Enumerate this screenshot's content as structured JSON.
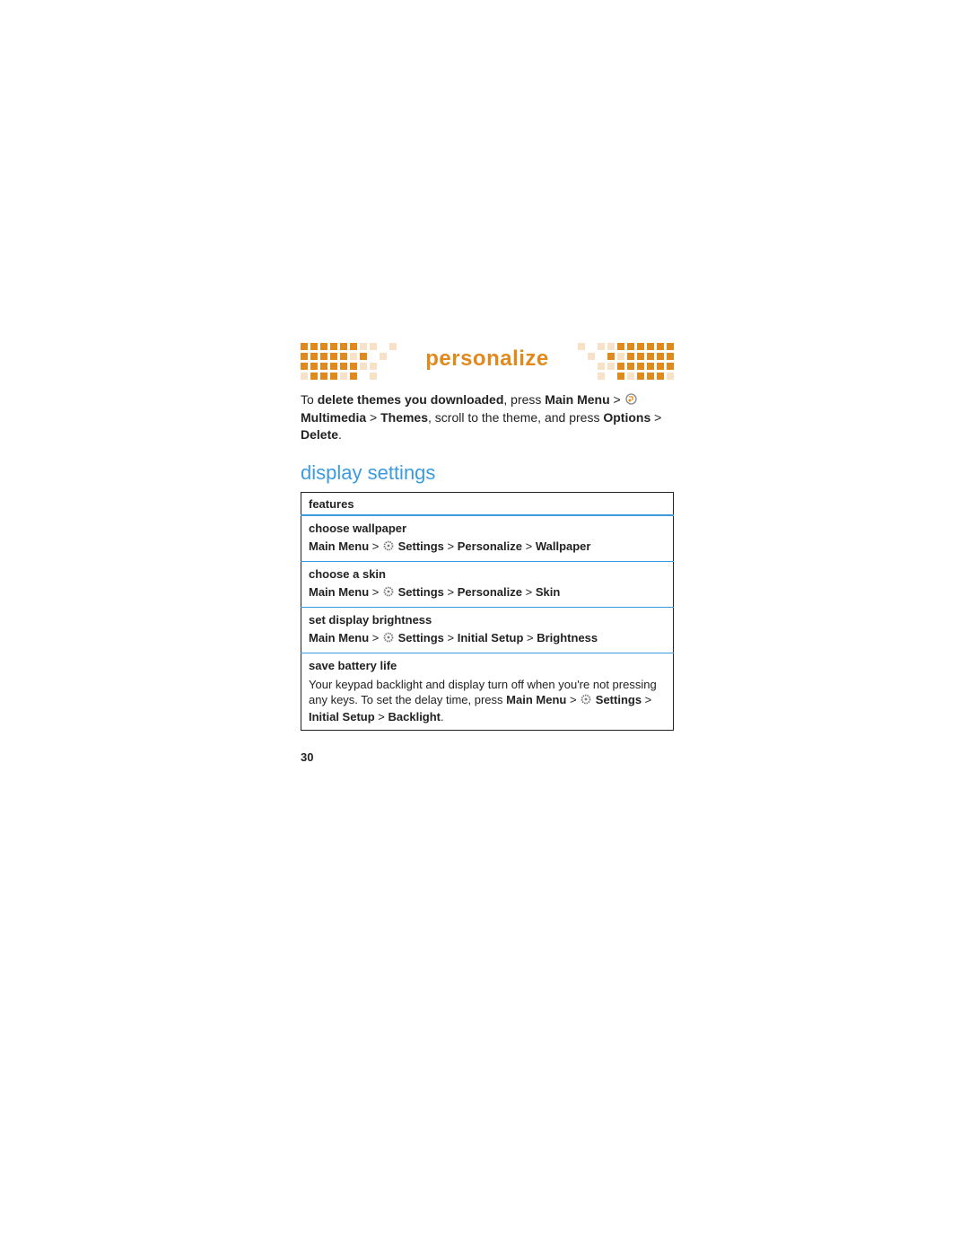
{
  "banner": {
    "title": "personalize"
  },
  "intro": {
    "t1": "To ",
    "bold1": "delete themes you downloaded",
    "t2": ", press ",
    "m1": "Main Menu",
    "gt1": " > ",
    "m2": "Multimedia",
    "gt2": " > ",
    "m3": "Themes",
    "t3": ", scroll to the theme, and press ",
    "m4": "Options",
    "gt3": " > ",
    "m5": "Delete",
    "t4": "."
  },
  "section_title": "display settings",
  "table": {
    "header": "features",
    "rows": [
      {
        "title": "choose wallpaper",
        "path": {
          "p0": "Main Menu",
          "s0": " > ",
          "icon": "gear",
          "p1": " Settings",
          "s1": " > ",
          "p2": "Personalize",
          "s2": " > ",
          "p3": "Wallpaper"
        }
      },
      {
        "title": "choose a skin",
        "path": {
          "p0": "Main Menu",
          "s0": " > ",
          "icon": "gear",
          "p1": " Settings",
          "s1": " > ",
          "p2": "Personalize",
          "s2": " > ",
          "p3": "Skin"
        }
      },
      {
        "title": "set display brightness",
        "path": {
          "p0": "Main Menu",
          "s0": " > ",
          "icon": "gear",
          "p1": " Settings",
          "s1": " > ",
          "p2": "Initial Setup",
          "s2": " > ",
          "p3": "Brightness"
        }
      },
      {
        "title": "save battery life",
        "body1": "Your keypad backlight and display turn off when you're not pressing any keys. To set the delay time, press ",
        "path": {
          "p0": "Main Menu",
          "s0": " > ",
          "icon": "gear",
          "p1": " Settings",
          "s1": " > ",
          "p2": "Initial Setup",
          "s2": " > ",
          "p3": "Backlight"
        },
        "body2": "."
      }
    ]
  },
  "page_number": "30"
}
